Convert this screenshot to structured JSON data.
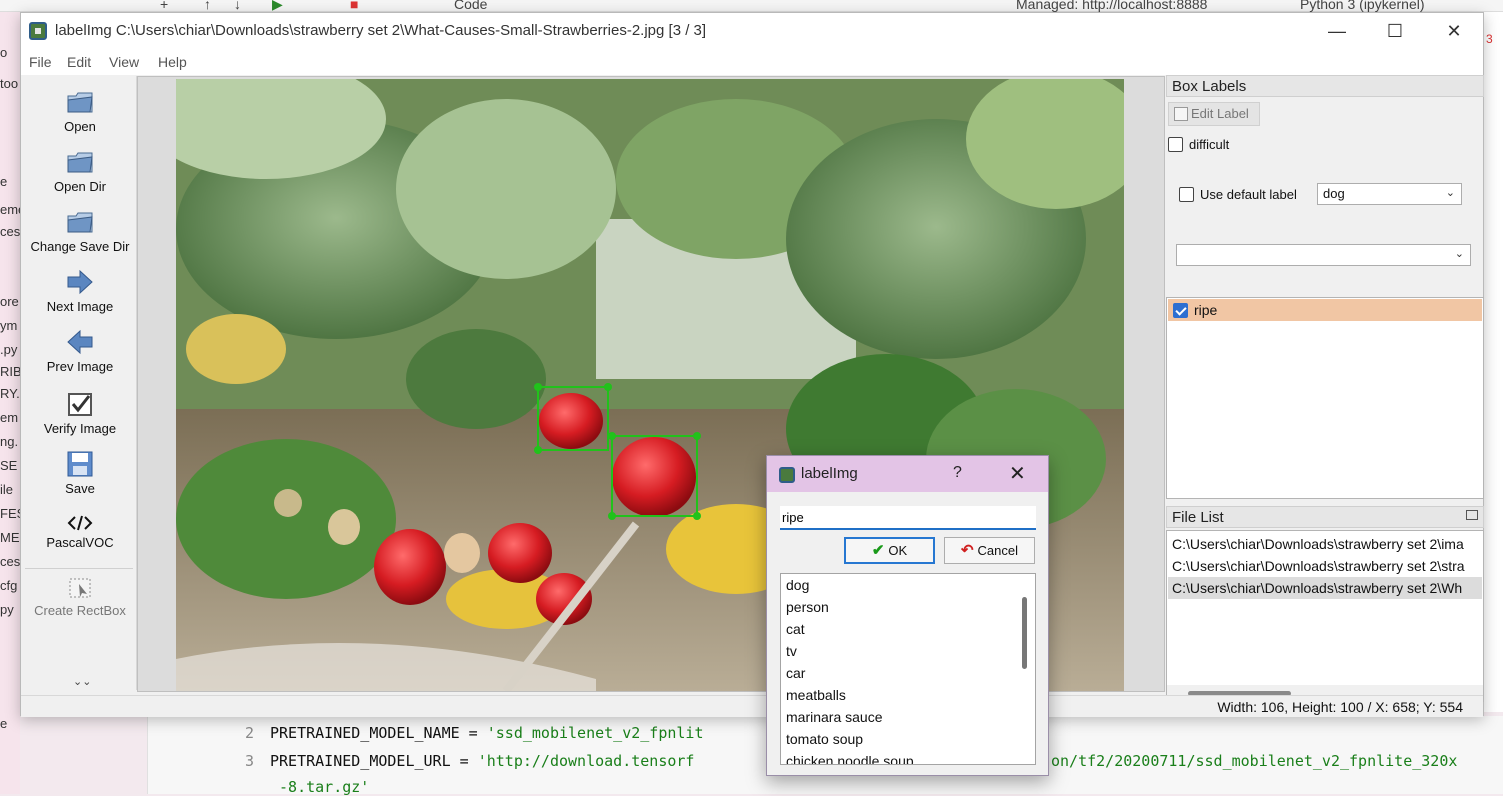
{
  "background": {
    "toolbar_items": [
      "+",
      "↑",
      "↓",
      "▶",
      "■"
    ],
    "kernel_mode": "Code",
    "server": "Managed: http://localhost:8888",
    "kernel": "Python 3 (ipykernel)",
    "left_fragments": [
      "o",
      "too",
      "e",
      "eme",
      "ces",
      "ore",
      "ym",
      ".py",
      "RIBI",
      "RY.",
      "em",
      "ng.",
      "SE",
      "ile",
      "FEST",
      "ME.",
      "ces",
      "cfg",
      "py",
      "e"
    ],
    "right_fragment": "3",
    "code": [
      {
        "num": "2",
        "kw": "PRETRAINED_MODEL_NAME = ",
        "str": "'ssd_mobilenet_v2_fpnlit"
      },
      {
        "num": "3",
        "kw": "PRETRAINED_MODEL_URL = ",
        "str": "'http://download.tensorf"
      },
      {
        "num": "",
        "kw": "",
        "str": " -8.tar.gz'"
      }
    ],
    "code_tail": "on/tf2/20200711/ssd_mobilenet_v2_fpnlite_320x"
  },
  "window": {
    "title": "labelImg C:\\Users\\chiar\\Downloads\\strawberry set 2\\What-Causes-Small-Strawberries-2.jpg [3 / 3]",
    "controls": {
      "minimize": "—",
      "maximize": "☐",
      "close": "✕"
    }
  },
  "menu": [
    "File",
    "Edit",
    "View",
    "Help"
  ],
  "tools": [
    {
      "label": "Open",
      "icon": "open-folder-icon"
    },
    {
      "label": "Open Dir",
      "icon": "open-dir-icon"
    },
    {
      "label": "Change Save Dir",
      "icon": "save-dir-icon"
    },
    {
      "label": "Next Image",
      "icon": "next-arrow-icon"
    },
    {
      "label": "Prev Image",
      "icon": "prev-arrow-icon"
    },
    {
      "label": "Verify Image",
      "icon": "verify-check-icon"
    },
    {
      "label": "Save",
      "icon": "floppy-icon"
    },
    {
      "label": "PascalVOC",
      "icon": "code-tag-icon"
    },
    {
      "label": "Create RectBox",
      "icon": "rect-box-icon"
    }
  ],
  "more_chevron": "⌄⌄",
  "box_labels": {
    "title": "Box Labels",
    "edit_label": "Edit Label",
    "difficult": "difficult",
    "use_default": "Use default label",
    "default_value": "dog",
    "second_combo_value": "",
    "labels": [
      {
        "name": "ripe",
        "checked": true
      }
    ]
  },
  "file_list": {
    "title": "File List",
    "items": [
      "C:\\Users\\chiar\\Downloads\\strawberry set 2\\ima",
      "C:\\Users\\chiar\\Downloads\\strawberry set 2\\stra",
      "C:\\Users\\chiar\\Downloads\\strawberry set 2\\Wh"
    ],
    "selected_index": 2
  },
  "status": "Width: 106, Height: 100 / X: 658; Y: 554",
  "dialog": {
    "title": "labelImg",
    "help": "?",
    "close": "✕",
    "input_value": "ripe",
    "ok": "OK",
    "cancel": "Cancel",
    "options": [
      "dog",
      "person",
      "cat",
      "tv",
      "car",
      "meatballs",
      "marinara sauce",
      "tomato soup",
      "chicken noodle soup"
    ]
  },
  "colors": {
    "selected_label_row": "#f1c6a4",
    "dialog_titlebar": "#e3c4e6",
    "bbox": "#21c21b",
    "accent": "#1f6fc6"
  }
}
